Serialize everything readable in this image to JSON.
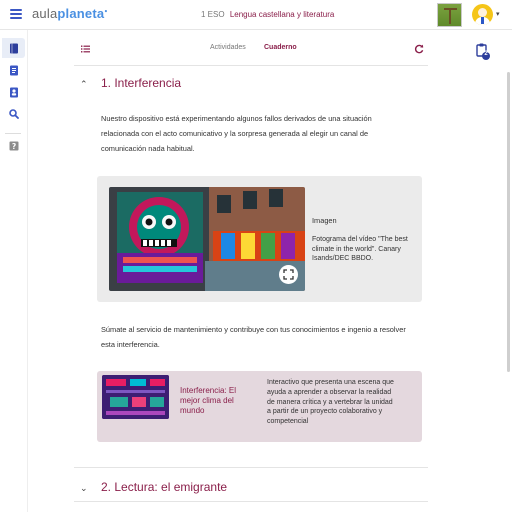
{
  "header": {
    "logo_part1": "aula",
    "logo_part2": "planeta",
    "grade": "1 ESO",
    "subject": "Lengua castellana y literatura"
  },
  "tabs": {
    "activities": "Actividades",
    "notebook": "Cuaderno"
  },
  "sections": [
    {
      "title": "1. Interferencia",
      "expanded": true
    },
    {
      "title": "2. Lectura: el emigrante",
      "expanded": false
    }
  ],
  "intro_text": "Nuestro dispositivo está experimentando algunos fallos derivados de una situación relacionada con el acto comunicativo y la sorpresa generada al elegir un canal de comunicación nada habitual.",
  "media": {
    "label": "Imagen",
    "caption": "Fotograma del vídeo \"The best climate in the world\". Canary Isands/DEC BBDO."
  },
  "call_text": "Súmate al servicio de mantenimiento y contribuye con tus conocimientos e ingenio a resolver esta interferencia.",
  "interactive": {
    "title": "Interferencia: El mejor clima del mundo",
    "description": "Interactivo que presenta una escena que ayuda a aprender a observar la realidad de manera crítica y a vertebrar la unidad a partir de un proyecto colaborativo y competencial"
  },
  "right_rail": {
    "badge_count": "2"
  },
  "icons": {
    "menu": "hamburger-icon",
    "list": "list-icon",
    "refresh": "refresh-icon",
    "book": "book-icon",
    "notebook": "notebook-icon",
    "profile": "profile-card-icon",
    "search": "search-icon",
    "help": "help-icon",
    "clipboard": "clipboard-icon",
    "fullscreen": "fullscreen-icon"
  },
  "colors": {
    "brand_blue": "#3b57c4",
    "accent_maroon": "#8a1f4a",
    "interactive_card": "#e4d8de",
    "media_card": "#ebebeb"
  }
}
